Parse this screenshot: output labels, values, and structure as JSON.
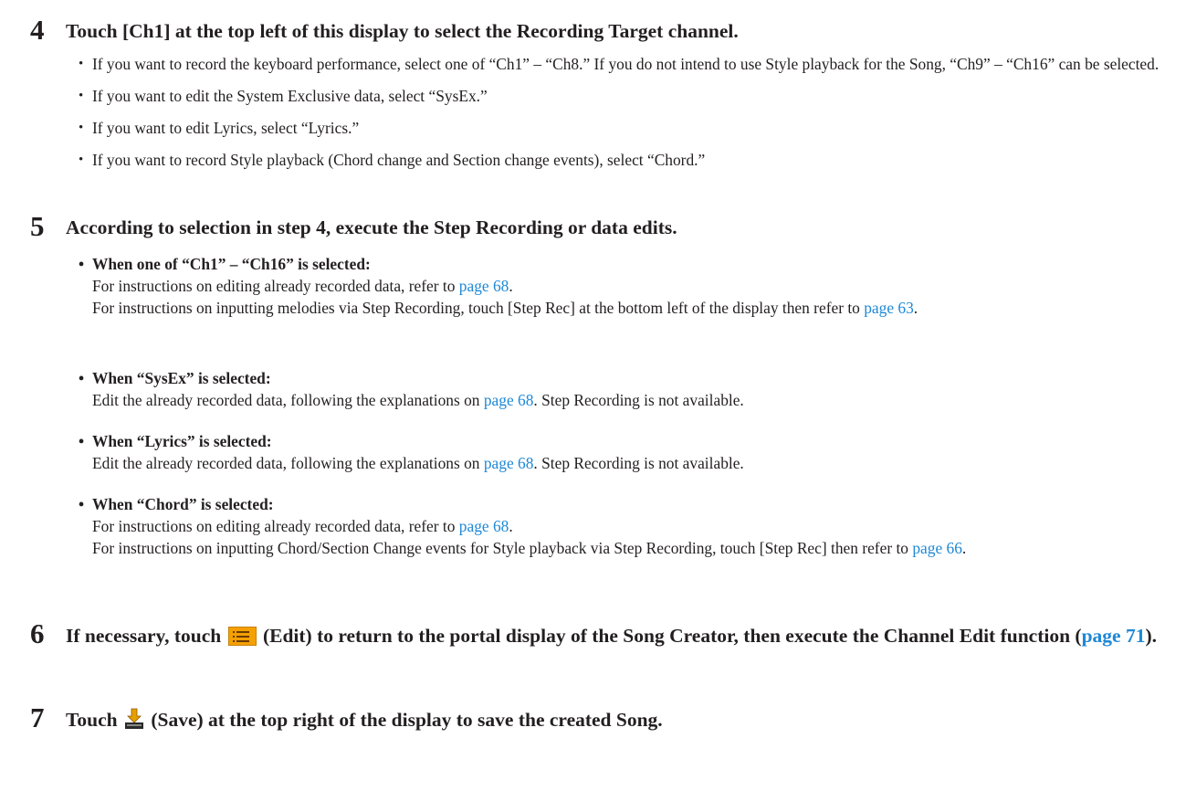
{
  "step4": {
    "number": "4",
    "title": "Touch [Ch1] at the top left of this display to select the Recording Target channel.",
    "bullets": [
      "If you want to record the keyboard performance, select one of “Ch1” – “Ch8.” If you do not intend to use Style playback for the Song, “Ch9” – “Ch16” can be selected.",
      "If you want to edit the System Exclusive data, select “SysEx.”",
      "If you want to edit Lyrics, select “Lyrics.”",
      "If you want to record Style playback (Chord change and Section change events), select “Chord.”"
    ]
  },
  "step5": {
    "number": "5",
    "title": "According to selection in step 4, execute the Step Recording or data edits.",
    "ch": {
      "heading": "When one of “Ch1” – “Ch16” is selected:",
      "line1_pre": "For instructions on editing already recorded data, refer to ",
      "line1_link": "page 68",
      "line1_post": ".",
      "line2_pre": "For instructions on inputting melodies via Step Recording, touch [Step Rec] at the bottom left of the display then refer to ",
      "line2_link": "page 63",
      "line2_post": "."
    },
    "sysex": {
      "heading": "When “SysEx” is selected:",
      "pre": "Edit the already recorded data, following the explanations on ",
      "link": "page 68",
      "post": ". Step Recording is not available."
    },
    "lyrics": {
      "heading": "When “Lyrics” is selected:",
      "pre": "Edit the already recorded data, following the explanations on ",
      "link": "page 68",
      "post": ". Step Recording is not available."
    },
    "chord": {
      "heading": "When “Chord” is selected:",
      "line1_pre": "For instructions on editing already recorded data, refer to ",
      "line1_link": "page 68",
      "line1_post": ".",
      "line2_pre": "For instructions on inputting Chord/Section Change events for Style playback via Step Recording, touch [Step Rec] then refer to ",
      "line2_link": "page 66",
      "line2_post": "."
    }
  },
  "step6": {
    "number": "6",
    "pre": "If necessary, touch ",
    "icon": "edit-list-icon",
    "post_icon": " (Edit) to return to the portal display of the Song Creator, then execute the Channel Edit function (",
    "link": "page 71",
    "post": ")."
  },
  "step7": {
    "number": "7",
    "pre": "Touch ",
    "icon": "save-download-icon",
    "post": " (Save) at the top right of the display to save the created Song."
  },
  "colors": {
    "text": "#231f20",
    "link": "#1e88d6",
    "edit_icon": "#f4a000"
  }
}
